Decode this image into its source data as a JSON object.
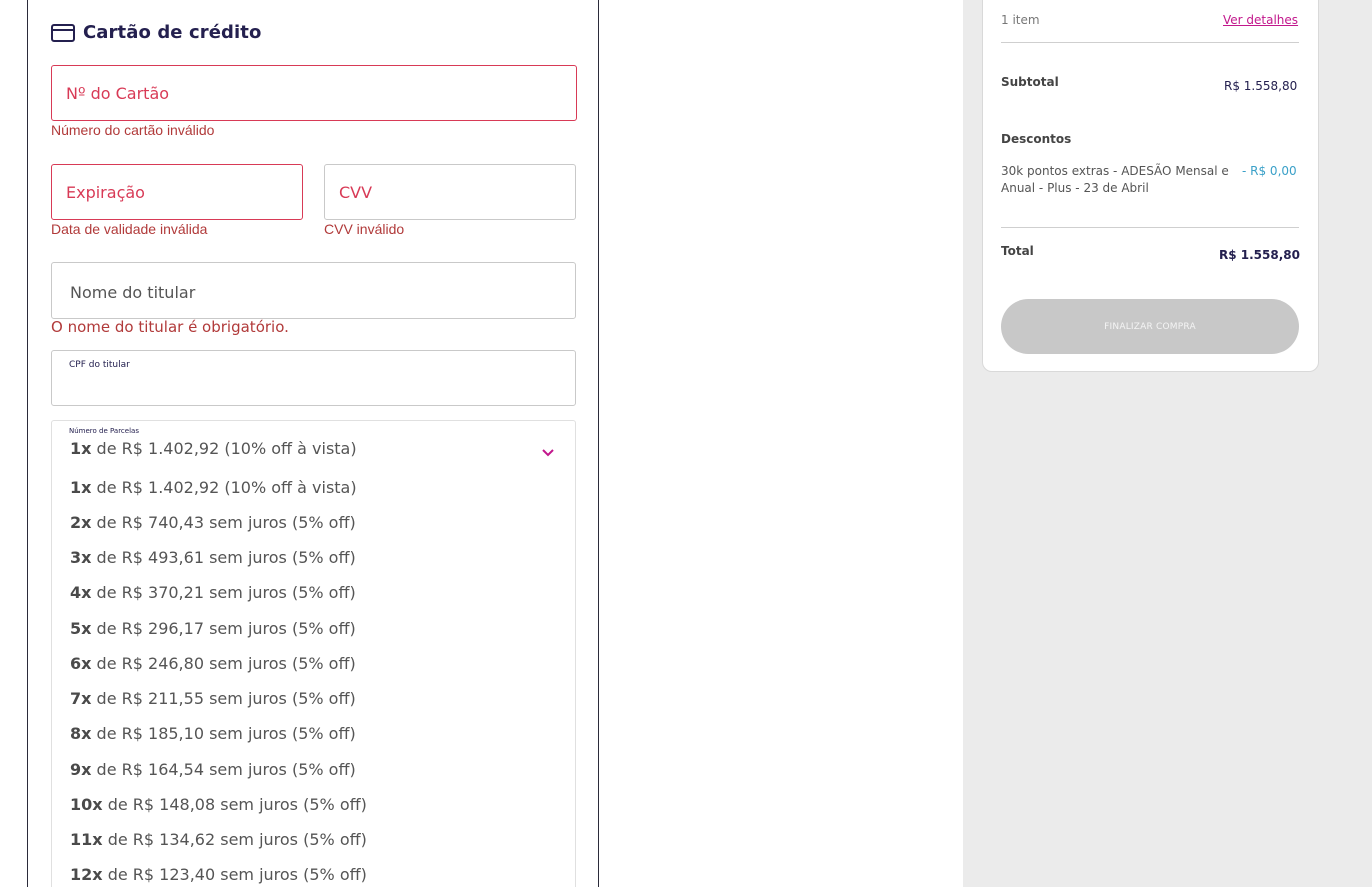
{
  "payment": {
    "title": "Cartão de crédito",
    "card_number": {
      "placeholder": "Nº do Cartão",
      "error": "Número do cartão inválido"
    },
    "expiration": {
      "placeholder": "Expiração",
      "error": "Data de validade inválida"
    },
    "cvv": {
      "placeholder": "CVV",
      "error": "CVV inválido"
    },
    "holder_name": {
      "placeholder": "Nome do titular",
      "error": "O nome do titular é obrigatório."
    },
    "holder_cpf": {
      "label": "CPF do titular"
    },
    "installments": {
      "label": "Número de Parcelas",
      "selected": {
        "count": "1x",
        "text": "de R$ 1.402,92 (10% off à vista)"
      },
      "options": [
        {
          "count": "1x",
          "text": "de R$ 1.402,92 (10% off à vista)"
        },
        {
          "count": "2x",
          "text": "de R$ 740,43 sem juros (5% off)"
        },
        {
          "count": "3x",
          "text": "de R$ 493,61 sem juros (5% off)"
        },
        {
          "count": "4x",
          "text": "de R$ 370,21 sem juros (5% off)"
        },
        {
          "count": "5x",
          "text": "de R$ 296,17 sem juros (5% off)"
        },
        {
          "count": "6x",
          "text": "de R$ 246,80 sem juros (5% off)"
        },
        {
          "count": "7x",
          "text": "de R$ 211,55 sem juros (5% off)"
        },
        {
          "count": "8x",
          "text": "de R$ 185,10 sem juros (5% off)"
        },
        {
          "count": "9x",
          "text": "de R$ 164,54 sem juros (5% off)"
        },
        {
          "count": "10x",
          "text": "de R$ 148,08 sem juros (5% off)"
        },
        {
          "count": "11x",
          "text": "de R$ 134,62 sem juros (5% off)"
        },
        {
          "count": "12x",
          "text": "de R$ 123,40 sem juros (5% off)"
        }
      ]
    }
  },
  "summary": {
    "items_count": "1 item",
    "details_link": "Ver detalhes",
    "subtotal_label": "Subtotal",
    "subtotal_value": "R$ 1.558,80",
    "discounts_label": "Descontos",
    "discount_description": "30k pontos extras - ADESÃO Mensal e Anual - Plus - 23 de Abril",
    "discount_value": "- R$ 0,00",
    "total_label": "Total",
    "total_value": "R$ 1.558,80",
    "finalize_button": "FINALIZAR COMPRA"
  },
  "colors": {
    "accent": "#c2178c",
    "error": "#d83a56",
    "title": "#24204f",
    "discount": "#3aa0c8",
    "sidebar_bg": "#ebebeb"
  },
  "icons": {
    "card": "credit-card-icon",
    "chevron": "chevron-down-icon"
  }
}
